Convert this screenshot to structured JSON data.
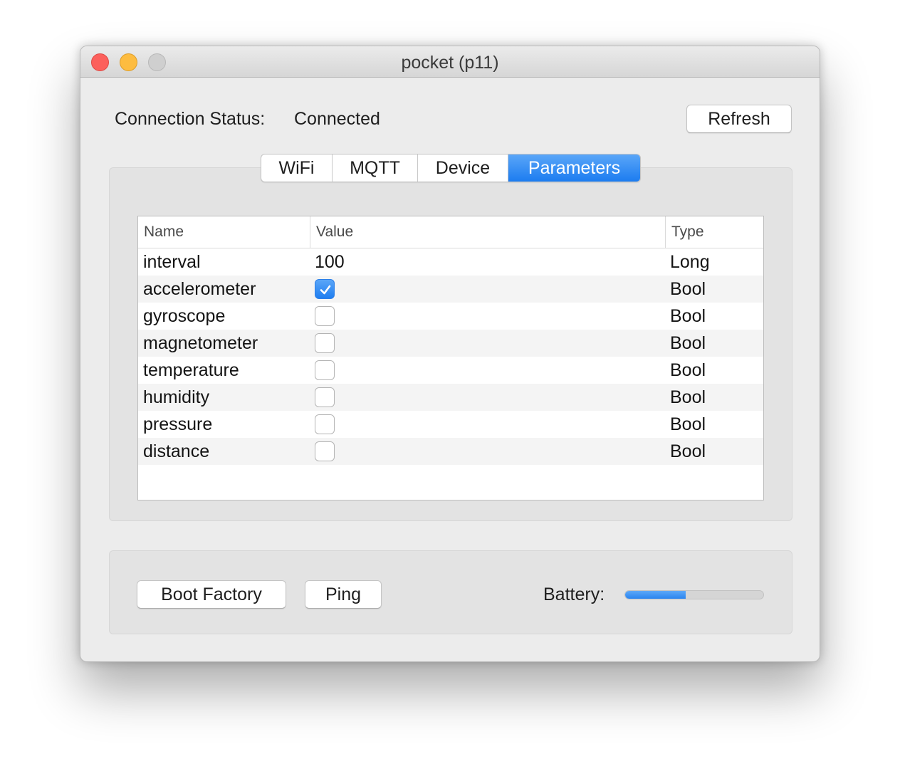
{
  "window": {
    "title": "pocket (p11)"
  },
  "connection": {
    "label": "Connection Status:",
    "value": "Connected"
  },
  "toolbar": {
    "refresh_label": "Refresh"
  },
  "tabs": [
    {
      "label": "WiFi",
      "active": false
    },
    {
      "label": "MQTT",
      "active": false
    },
    {
      "label": "Device",
      "active": false
    },
    {
      "label": "Parameters",
      "active": true
    }
  ],
  "table": {
    "columns": [
      "Name",
      "Value",
      "Type"
    ],
    "rows": [
      {
        "name": "interval",
        "kind": "text",
        "value": "100",
        "type": "Long"
      },
      {
        "name": "accelerometer",
        "kind": "bool",
        "checked": true,
        "type": "Bool"
      },
      {
        "name": "gyroscope",
        "kind": "bool",
        "checked": false,
        "type": "Bool"
      },
      {
        "name": "magnetometer",
        "kind": "bool",
        "checked": false,
        "type": "Bool"
      },
      {
        "name": "temperature",
        "kind": "bool",
        "checked": false,
        "type": "Bool"
      },
      {
        "name": "humidity",
        "kind": "bool",
        "checked": false,
        "type": "Bool"
      },
      {
        "name": "pressure",
        "kind": "bool",
        "checked": false,
        "type": "Bool"
      },
      {
        "name": "distance",
        "kind": "bool",
        "checked": false,
        "type": "Bool"
      }
    ]
  },
  "actions": {
    "boot_factory_label": "Boot Factory",
    "ping_label": "Ping"
  },
  "battery": {
    "label": "Battery:",
    "level_percent": 44
  },
  "colors": {
    "accent": "#1f7ef0",
    "close": "#fc605c",
    "minimize": "#fdbc40",
    "zoom_disabled": "#cfcfcf"
  }
}
